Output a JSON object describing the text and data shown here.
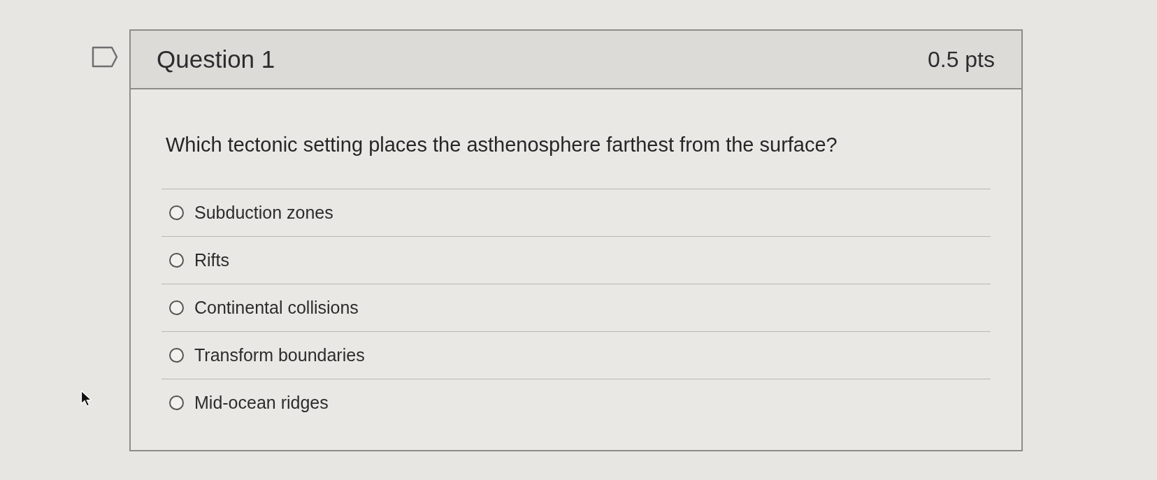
{
  "question": {
    "title": "Question 1",
    "points": "0.5 pts",
    "prompt": "Which tectonic setting places the asthenosphere farthest from the surface?",
    "answers": [
      {
        "label": "Subduction zones",
        "selected": false
      },
      {
        "label": "Rifts",
        "selected": false
      },
      {
        "label": "Continental collisions",
        "selected": false
      },
      {
        "label": "Transform boundaries",
        "selected": false
      },
      {
        "label": "Mid-ocean ridges",
        "selected": false
      }
    ]
  }
}
